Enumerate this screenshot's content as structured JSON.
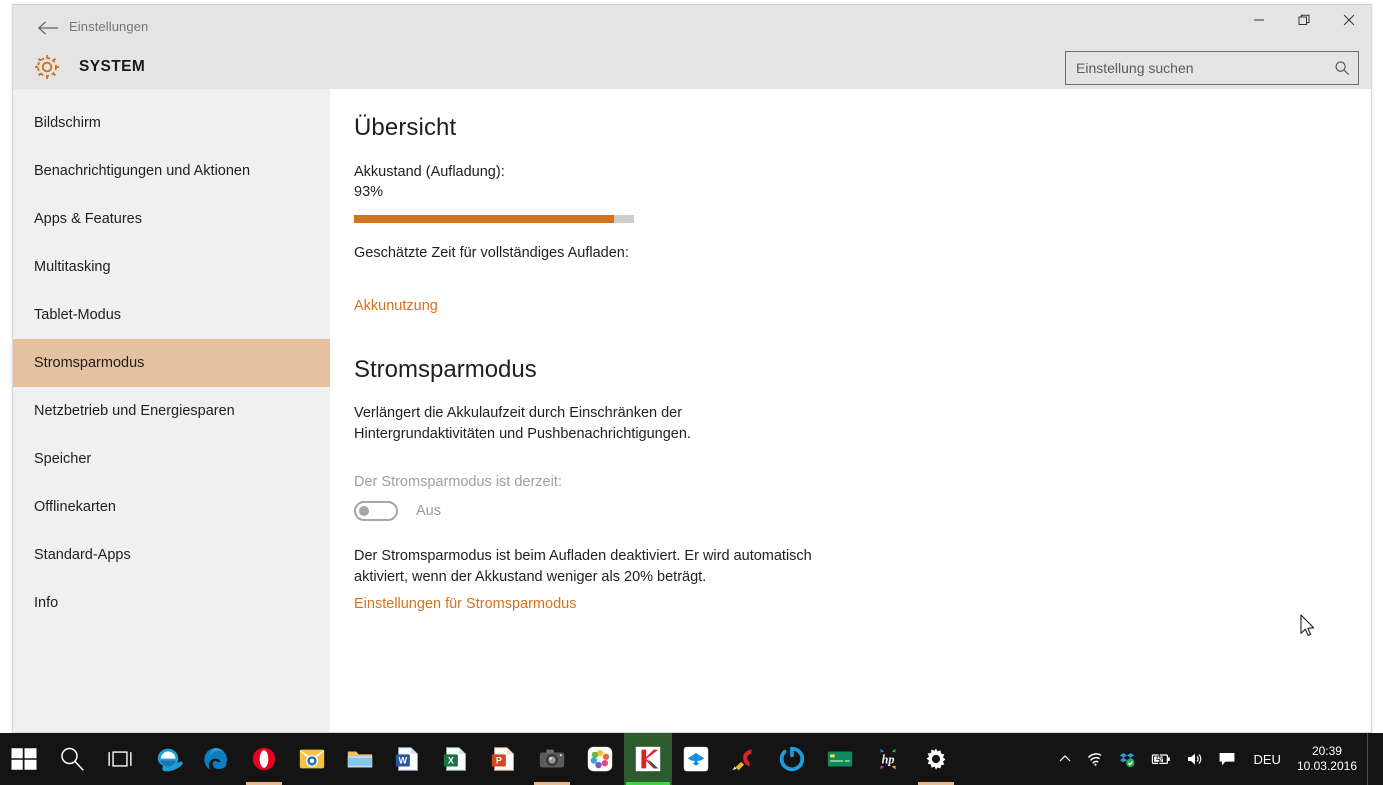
{
  "window": {
    "app_title": "Einstellungen",
    "page_title": "SYSTEM",
    "back_icon": "back-arrow-icon",
    "gear_icon": "gear-icon",
    "controls": {
      "minimize": "minimize-icon",
      "restore": "restore-icon",
      "close": "close-icon"
    }
  },
  "search": {
    "placeholder": "Einstellung suchen",
    "value": "",
    "icon": "search-icon"
  },
  "sidebar": {
    "items": [
      {
        "label": "Bildschirm",
        "selected": false
      },
      {
        "label": "Benachrichtigungen und Aktionen",
        "selected": false
      },
      {
        "label": "Apps & Features",
        "selected": false
      },
      {
        "label": "Multitasking",
        "selected": false
      },
      {
        "label": "Tablet-Modus",
        "selected": false
      },
      {
        "label": "Stromsparmodus",
        "selected": true
      },
      {
        "label": "Netzbetrieb und Energiesparen",
        "selected": false
      },
      {
        "label": "Speicher",
        "selected": false
      },
      {
        "label": "Offlinekarten",
        "selected": false
      },
      {
        "label": "Standard-Apps",
        "selected": false
      },
      {
        "label": "Info",
        "selected": false
      }
    ],
    "selected_bg": "#e5c1a0"
  },
  "overview": {
    "heading": "Übersicht",
    "battery_label": "Akkustand (Aufladung):",
    "battery_percent_text": "93%",
    "battery_percent_value": 93,
    "progress_color": "#d2731f",
    "progress_track_color": "#cccccc",
    "estimated_time_label": "Geschätzte Zeit für vollständiges Aufladen:",
    "battery_usage_link": "Akkunutzung"
  },
  "battery_saver": {
    "heading": "Stromsparmodus",
    "description": "Verlängert die Akkulaufzeit durch Einschränken der Hintergrundaktivitäten und Pushbenachrichtigungen.",
    "status_label": "Der Stromsparmodus ist derzeit:",
    "toggle_state": "Aus",
    "toggle_on": false,
    "note": "Der Stromsparmodus ist beim Aufladen deaktiviert. Er wird automatisch aktiviert, wenn der Akkustand weniger als 20% beträgt.",
    "settings_link": "Einstellungen für Stromsparmodus"
  },
  "taskbar": {
    "background": "#141414",
    "items": [
      {
        "name": "start-button",
        "icon": "windows-logo-icon",
        "active": false
      },
      {
        "name": "search-taskbar-button",
        "icon": "search-icon",
        "active": false
      },
      {
        "name": "task-view-button",
        "icon": "task-view-icon",
        "active": false
      },
      {
        "name": "internet-explorer-button",
        "icon": "internet-explorer-icon",
        "active": false
      },
      {
        "name": "microsoft-edge-button",
        "icon": "edge-icon",
        "active": false
      },
      {
        "name": "opera-button",
        "icon": "opera-icon",
        "active": true
      },
      {
        "name": "outlook-button",
        "icon": "outlook-icon",
        "active": false
      },
      {
        "name": "file-explorer-button",
        "icon": "file-explorer-icon",
        "active": false
      },
      {
        "name": "word-button",
        "icon": "word-icon",
        "active": false
      },
      {
        "name": "excel-button",
        "icon": "excel-icon",
        "active": false
      },
      {
        "name": "powerpoint-button",
        "icon": "powerpoint-icon",
        "active": false
      },
      {
        "name": "camera-app-button",
        "icon": "camera-icon",
        "active": true
      },
      {
        "name": "photos-button",
        "icon": "photos-icon",
        "active": false
      },
      {
        "name": "kaspersky-button",
        "icon": "kaspersky-icon",
        "active": true
      },
      {
        "name": "dropbox-button",
        "icon": "dropbox-icon",
        "active": false
      },
      {
        "name": "ccleaner-button",
        "icon": "ccleaner-icon",
        "active": false
      },
      {
        "name": "skype-button",
        "icon": "circle-arrow-icon",
        "active": false
      },
      {
        "name": "banking-app-button",
        "icon": "credit-card-icon",
        "active": false
      },
      {
        "name": "hp-button",
        "icon": "hp-icon",
        "active": false
      },
      {
        "name": "settings-button",
        "icon": "gear-icon",
        "active": true
      }
    ],
    "tray": {
      "chevron": "chevron-up-icon",
      "wifi": "wifi-icon",
      "dropbox": "dropbox-tray-icon",
      "battery": "battery-charging-icon",
      "volume": "volume-icon",
      "action_center": "action-center-icon",
      "language": "DEU",
      "time": "20:39",
      "date": "10.03.2016"
    }
  }
}
